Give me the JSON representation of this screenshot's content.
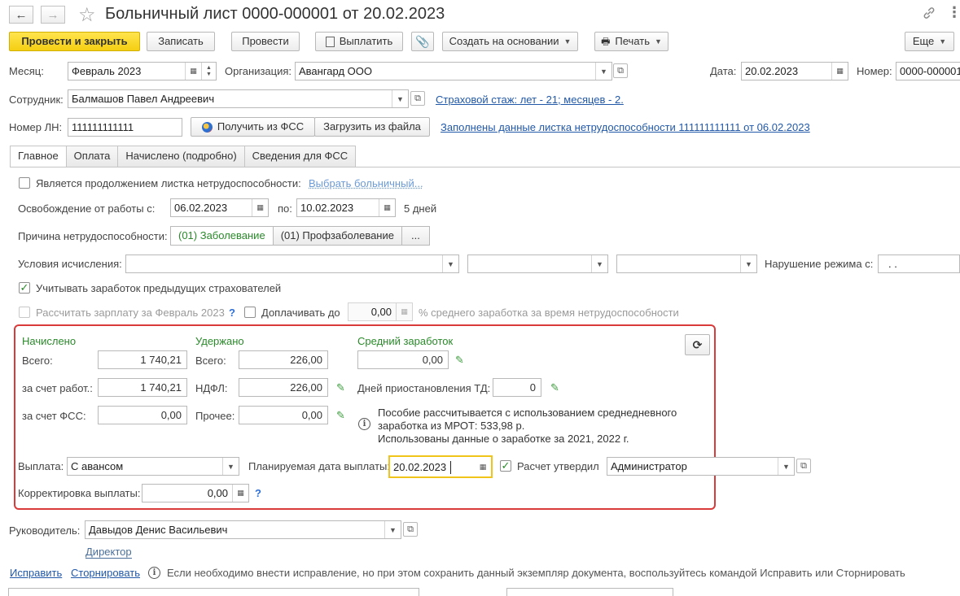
{
  "window": {
    "title": "Больничный лист 0000-000001 от 20.02.2023",
    "back_icon": "←",
    "forward_icon": "→",
    "star_icon": "☆",
    "link_icon": "🔗",
    "menu_icon": "⋮",
    "close_icon": "×"
  },
  "toolbar": {
    "post_close": "Провести и закрыть",
    "save": "Записать",
    "post": "Провести",
    "pay": "Выплатить",
    "create_based": "Создать на основании",
    "print": "Печать",
    "more": "Еще"
  },
  "header": {
    "month_label": "Месяц:",
    "month_value": "Февраль 2023",
    "org_label": "Организация:",
    "org_value": "Авангард ООО",
    "date_label": "Дата:",
    "date_value": "20.02.2023",
    "number_label": "Номер:",
    "number_value": "0000-000001",
    "employee_label": "Сотрудник:",
    "employee_value": "Балмашов Павел Андреевич",
    "insurance_link": "Страховой стаж: лет - 21; месяцев - 2.",
    "ln_label": "Номер ЛН:",
    "ln_value": "111111111111",
    "get_fss": "Получить из ФСС",
    "load_file": "Загрузить из файла",
    "filled_link": "Заполнены данные листка нетрудоспособности 111111111111 от 06.02.2023"
  },
  "tabs": [
    "Главное",
    "Оплата",
    "Начислено (подробно)",
    "Сведения для ФСС"
  ],
  "main": {
    "continuation_label": "Является продолжением листка нетрудоспособности:",
    "choose_sick": "Выбрать больничный...",
    "release_label": "Освобождение от работы с:",
    "release_from": "06.02.2023",
    "to_label": "по:",
    "release_to": "10.02.2023",
    "days": "5 дней",
    "cause_label": "Причина нетрудоспособности:",
    "cause_disease": "(01) Заболевание",
    "cause_prof": "(01) Профзаболевание",
    "cause_more": "...",
    "conditions_label": "Условия исчисления:",
    "violation_label": "Нарушение режима с:",
    "violation_value": ".  .",
    "consider_prev": "Учитывать заработок предыдущих страхователей",
    "calc_salary": "Рассчитать зарплату за Февраль 2023",
    "extra_pay": "Доплачивать до",
    "extra_value": "0,00",
    "extra_suffix": "% среднего заработка за время нетрудоспособности"
  },
  "calc": {
    "accrued_header": "Начислено",
    "withheld_header": "Удержано",
    "avg_header": "Средний заработок",
    "total_label": "Всего:",
    "total_value": "1 740,21",
    "employer_label": "за счет работ.:",
    "employer_value": "1 740,21",
    "fss_label": "за счет ФСС:",
    "fss_value": "0,00",
    "w_total_label": "Всего:",
    "w_total_value": "226,00",
    "ndfl_label": "НДФЛ:",
    "ndfl_value": "226,00",
    "other_label": "Прочее:",
    "other_value": "0,00",
    "avg_value": "0,00",
    "suspend_label": "Дней приостановления ТД:",
    "suspend_value": "0",
    "info_line1": "Пособие рассчитывается с использованием среднедневного",
    "info_line2": "заработка из МРОТ: 533,98 р.",
    "info_line3": "Использованы данные о заработке за  2021,  2022 г.",
    "payment_label": "Выплата:",
    "payment_value": "С авансом",
    "planned_label": "Планируемая дата выплаты:",
    "planned_value": "20.02.2023",
    "approved_label": "Расчет утвердил",
    "approved_value": "Администратор",
    "correction_label": "Корректировка выплаты:",
    "correction_value": "0,00"
  },
  "footer": {
    "head_label": "Руководитель:",
    "head_value": "Давыдов Денис Васильевич",
    "position": "Директор",
    "fix_link": "Исправить",
    "reverse_link": "Сторнировать",
    "hint": "Если необходимо внести исправление, но при этом сохранить данный экземпляр документа, воспользуйтесь командой Исправить или Сторнировать"
  },
  "colors": {
    "primary_button": "#f5cf12",
    "highlight_box": "#d93a3a",
    "green_text": "#2a8a2a",
    "link": "#2158a8"
  }
}
